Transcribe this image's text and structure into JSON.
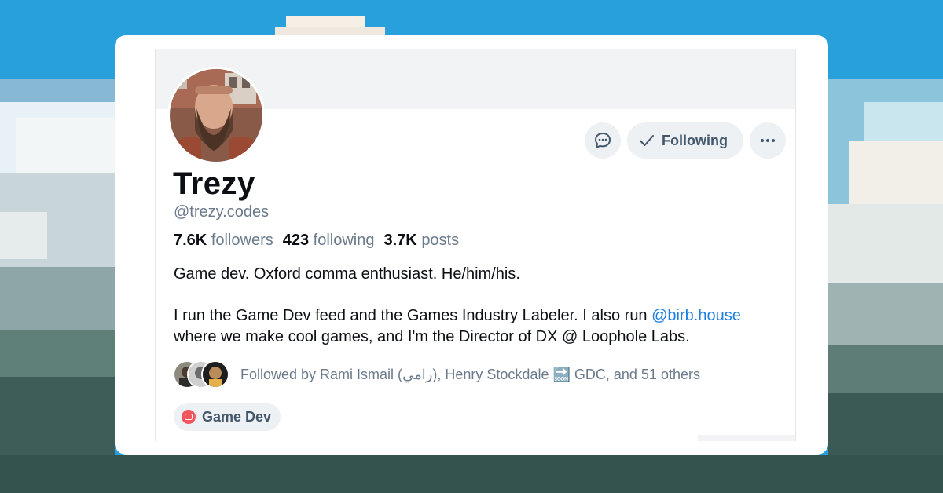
{
  "profile": {
    "name": "Trezy",
    "handle": "@trezy.codes",
    "stats": {
      "followers_count": "7.6K",
      "followers_label": "followers",
      "following_count": "423",
      "following_label": "following",
      "posts_count": "3.7K",
      "posts_label": "posts"
    },
    "bio": {
      "line1": "Game dev. Oxford comma enthusiast. He/him/his.",
      "p2_before": "I run the Game Dev feed and the Games Industry Labeler. I also run ",
      "p2_mention": "@birb.house",
      "p2_after": " where we make cool games, and I'm the Director of DX @ Loophole Labs."
    },
    "followed_by": {
      "prefix": "Followed by Rami Ismail (رامي), Henry Stockdale ",
      "emoji": "🔜",
      "suffix": " GDC, and 51 others"
    },
    "feed_pill": {
      "label": "Game Dev"
    }
  },
  "actions": {
    "message_icon": "chat-bubble-icon",
    "follow_label": "Following",
    "follow_icon": "checkmark-icon",
    "more_icon": "ellipsis-icon"
  },
  "colors": {
    "sky": "#2a9fd8",
    "accent_link": "#1f7fe0",
    "pill_bg": "#eef1f4",
    "feed_icon": "#f0565c"
  }
}
